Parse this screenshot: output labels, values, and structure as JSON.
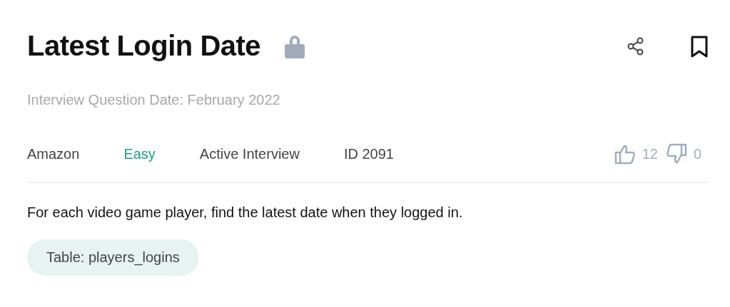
{
  "title": "Latest Login Date",
  "locked": true,
  "question_date": "Interview Question Date: February 2022",
  "meta": [
    {
      "kind": "company",
      "text": "Amazon"
    },
    {
      "kind": "difficulty",
      "text": "Easy"
    },
    {
      "kind": "status",
      "text": "Active Interview"
    },
    {
      "kind": "id",
      "text": "ID 2091"
    }
  ],
  "votes": {
    "up": "12",
    "down": "0"
  },
  "description": "For each video game player, find the latest date when they logged in.",
  "tables": [
    "Table: players_logins"
  ]
}
